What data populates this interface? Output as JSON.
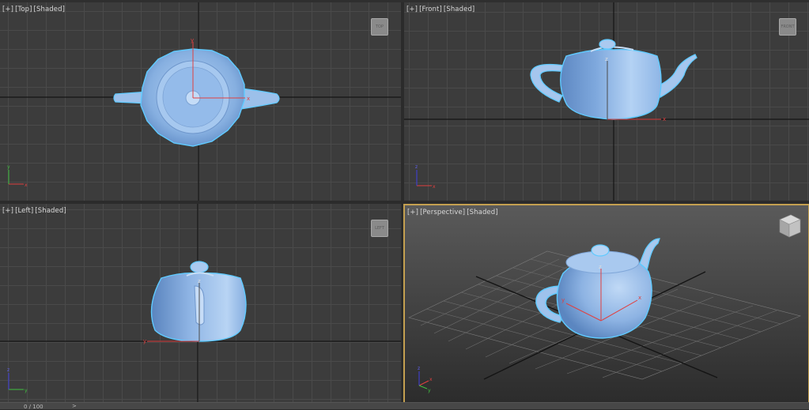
{
  "viewports": {
    "top": {
      "plus": "[+]",
      "view": "[Top]",
      "shading": "[Shaded]",
      "cube_label": "TOP"
    },
    "front": {
      "plus": "[+]",
      "view": "[Front]",
      "shading": "[Shaded]",
      "cube_label": "FRONT"
    },
    "left": {
      "plus": "[+]",
      "view": "[Left]",
      "shading": "[Shaded]",
      "cube_label": "LEFT"
    },
    "persp": {
      "plus": "[+]",
      "view": "[Perspective]",
      "shading": "[Shaded]",
      "active": true
    }
  },
  "axes": {
    "x": "x",
    "y": "y",
    "z": "z"
  },
  "timeline": {
    "counter": "0 / 100",
    "next_arrow": ">"
  },
  "colors": {
    "viewport_bg": "#3c3c3c",
    "grid": "#4a4a4a",
    "teapot": "#8fb6e6",
    "selection_outline": "#5fcaff",
    "active_border": "#c4a050",
    "gizmo_x": "#e04040",
    "gizmo_y": "#40c040",
    "gizmo_z": "#4040e0"
  },
  "icons": {
    "viewcube": "viewcube-icon",
    "axis_tripod": "axis-tripod-icon"
  }
}
